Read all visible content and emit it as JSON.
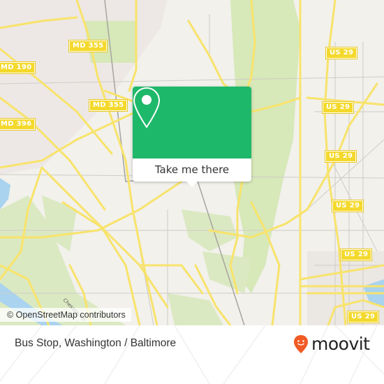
{
  "map": {
    "colors": {
      "land": "#f2f1ec",
      "urban": "#ede8e5",
      "park": "#d7e8b9",
      "water": "#a9d3ee",
      "road_major": "#f8e36b",
      "road_minor": "#c9c6c0",
      "rail": "#9d9a94",
      "shield_bg": "#f4d92c"
    },
    "route_shields": [
      {
        "id": "md355-north",
        "label": "MD 355"
      },
      {
        "id": "md355-south",
        "label": "MD 355"
      },
      {
        "id": "md190",
        "label": "MD 190"
      },
      {
        "id": "md396",
        "label": "MD 396"
      },
      {
        "id": "us29-1",
        "label": "US 29"
      },
      {
        "id": "us29-2",
        "label": "US 29"
      },
      {
        "id": "us29-3",
        "label": "US 29"
      },
      {
        "id": "us29-4",
        "label": "US 29"
      },
      {
        "id": "us29-5",
        "label": "US 29"
      },
      {
        "id": "us29-6",
        "label": "US 29"
      }
    ],
    "street_label": "Chesapeake",
    "attribution": "© OpenStreetMap contributors"
  },
  "popup": {
    "icon": "map-pin-icon",
    "accent": "#1eb86a",
    "action_label": "Take me there"
  },
  "footer": {
    "title": "Bus Stop, Washington / Baltimore",
    "brand": {
      "name": "moovit",
      "logo_icon": "moovit-smiley-pin-icon",
      "logo_color": "#f15a24"
    }
  }
}
